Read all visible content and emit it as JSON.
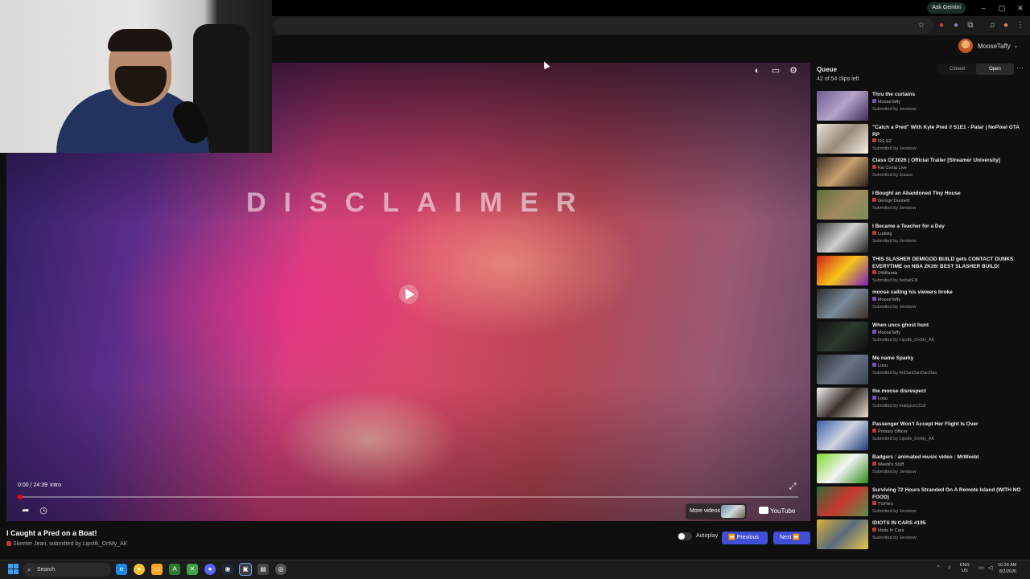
{
  "browser": {
    "ask_gemini": "Ask Gemini",
    "controls": {
      "minimize": "–",
      "restore": "▢",
      "close": "✕"
    }
  },
  "site": {
    "username": "MooseTaffy"
  },
  "player": {
    "overlay_text": "DISCLAIMER",
    "time": "0:00 / 24:39",
    "chapter": "Intro",
    "progress": 0.0,
    "more_videos": "More videos",
    "youtube": "YouTube"
  },
  "video": {
    "title": "I Caught a Pred on a Boat!",
    "meta": "Skeeter Jean, submitted by Lipstik_OnMy_AK",
    "autoplay_label": "Autoplay",
    "previous_label": "Previous",
    "next_label": "Next"
  },
  "queue": {
    "title": "Queue",
    "count": "42 of 54 clips left",
    "closed_label": "Closed",
    "open_label": "Open",
    "items": [
      {
        "title": "Thru the curtains",
        "channel": "MooseTaffy",
        "submitted": "Submitted by Jerebow",
        "color": "#7a4fbf",
        "thumb": "linear-gradient(135deg,#6b5d8f,#b6a3c9,#3d2f5a)"
      },
      {
        "title": "\"Catch a Pred\" With Kyle Pred // S1E1 - Patar | NoPixel GTA RP",
        "channel": "GG EZ",
        "submitted": "Submitted by Jerebow",
        "color": "#c0392b",
        "thumb": "linear-gradient(135deg,#e9e4dc,#9a8b7a,#f5f0e8)"
      },
      {
        "title": "Class Of 2026 | Official Trailer [Streamer University]",
        "channel": "Kai Cenat Live",
        "submitted": "Submitted by kraaze",
        "color": "#c0392b",
        "thumb": "linear-gradient(135deg,#3b2a1e,#c8a070,#2a1d14)"
      },
      {
        "title": "I Bought an Abandoned Tiny House",
        "channel": "George Dunnett",
        "submitted": "Submitted by Jerebow",
        "color": "#c0392b",
        "thumb": "linear-gradient(135deg,#5a6e3a,#a08a60,#7c8c5a)"
      },
      {
        "title": "I Became a Teacher for a Day",
        "channel": "Ludwig",
        "submitted": "Submitted by Jerebow",
        "color": "#c0392b",
        "thumb": "linear-gradient(135deg,#3a3a3a,#cfcfcf,#1e1e1e)"
      },
      {
        "title": "THIS SLASHER DEMIGOD BUILD gets CONTACT DUNKS EVERYTIME on NBA 2K26! BEST SLASHER BUILD!",
        "channel": "24kBands",
        "submitted": "Submitted by fentalrEB",
        "color": "#c0392b",
        "thumb": "linear-gradient(135deg,#d21e1e,#f5c518,#7a1fbf)"
      },
      {
        "title": "moose calling his viewers broke",
        "channel": "MooseTaffy",
        "submitted": "Submitted by Jerebow",
        "color": "#7a4fbf",
        "thumb": "linear-gradient(135deg,#2c2c2c,#7b8a99,#3a2e28)"
      },
      {
        "title": "When uncs ghost hunt",
        "channel": "MooseTaffy",
        "submitted": "Submitted by Lipstik_OnMy_AK",
        "color": "#7a4fbf",
        "thumb": "linear-gradient(135deg,#111,#2d3a2d,#0c0c0c)"
      },
      {
        "title": "Me name Sparky",
        "channel": "Louu",
        "submitted": "Submitted by AnDanDanDanDan",
        "color": "#7a4fbf",
        "thumb": "linear-gradient(135deg,#2a2e36,#6b7484,#3b4250)"
      },
      {
        "title": "the moose disrespect",
        "channel": "Louu",
        "submitted": "Submitted by mattyice1218",
        "color": "#7a4fbf",
        "thumb": "linear-gradient(135deg,#f2f2f2,#3a2f2a,#e8e0d8)"
      },
      {
        "title": "Passenger Won't Accept Her Flight Is Over",
        "channel": "Primary Officer",
        "submitted": "Submitted by Lipstik_OnMy_AK",
        "color": "#c0392b",
        "thumb": "linear-gradient(135deg,#3a5ba8,#d0d6e2,#1f3a7a)"
      },
      {
        "title": "Badgers : animated music video : MrWeebl",
        "channel": "Weebl's Stuff",
        "submitted": "Submitted by Jerebow",
        "color": "#c0392b",
        "thumb": "linear-gradient(135deg,#7cd92a,#f4f4f4,#2d8a18)"
      },
      {
        "title": "Surviving 72 Hours Stranded On A Remote Island (WITH NO FOOD)",
        "channel": "TGFbro",
        "submitted": "Submitted by Jerebow",
        "color": "#c0392b",
        "thumb": "linear-gradient(135deg,#2f6e3a,#c7362f,#5d8f4a)"
      },
      {
        "title": "IDIOTS IN CARS #195",
        "channel": "Idiots In Cars",
        "submitted": "Submitted by Jerebow",
        "color": "#c0392b",
        "thumb": "linear-gradient(135deg,#d8b23a,#5a6a7a,#e8c84a)"
      }
    ]
  },
  "taskbar": {
    "search_label": "Search",
    "lang_line1": "ENG",
    "lang_line2": "US",
    "clock_time": "10:28 AM",
    "clock_date": "8/2/2026"
  }
}
